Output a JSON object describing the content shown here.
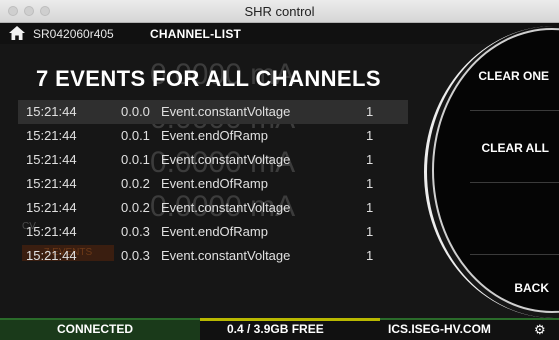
{
  "window": {
    "title": "SHR control"
  },
  "header": {
    "device": "SR042060r405",
    "view": "CHANNEL-LIST"
  },
  "events": {
    "title": "7 EVENTS FOR ALL CHANNELS",
    "rows": [
      {
        "time": "15:21:44",
        "address": "0.0.0",
        "name": "Event.constantVoltage",
        "value": "1",
        "selected": true
      },
      {
        "time": "15:21:44",
        "address": "0.0.1",
        "name": "Event.endOfRamp",
        "value": "1"
      },
      {
        "time": "15:21:44",
        "address": "0.0.1",
        "name": "Event.constantVoltage",
        "value": "1"
      },
      {
        "time": "15:21:44",
        "address": "0.0.2",
        "name": "Event.endOfRamp",
        "value": "1"
      },
      {
        "time": "15:21:44",
        "address": "0.0.2",
        "name": "Event.constantVoltage",
        "value": "1"
      },
      {
        "time": "15:21:44",
        "address": "0.0.3",
        "name": "Event.endOfRamp",
        "value": "1"
      },
      {
        "time": "15:21:44",
        "address": "0.0.3",
        "name": "Event.constantVoltage",
        "value": "1"
      }
    ]
  },
  "menu": {
    "clear_one": "CLEAR ONE",
    "clear_all": "CLEAR ALL",
    "back": "BACK"
  },
  "background": {
    "ghost_current": "0.0000 mA",
    "ghost_label": "CV",
    "ghost_events": "7 EVENTS"
  },
  "status": {
    "connection": "CONNECTED",
    "storage": "0.4 / 3.9GB FREE",
    "url": "ICS.ISEG-HV.COM"
  },
  "colors": {
    "status_green": "#1a3a1a",
    "accent_yellow": "#b8b800",
    "menu_circle": "#050505"
  }
}
